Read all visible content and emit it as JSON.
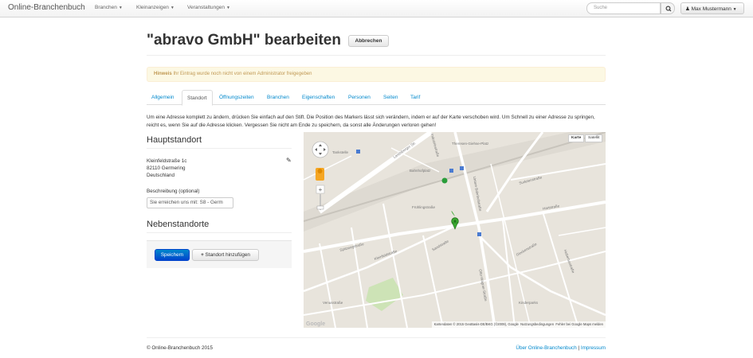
{
  "navbar": {
    "brand": "Online-Branchenbuch",
    "menus": [
      "Branchen",
      "Kleinanzeigen",
      "Veranstaltungen"
    ],
    "search_placeholder": "Suche",
    "user_name": "Max Mustermann"
  },
  "header": {
    "title": "\"abravo GmbH\" bearbeiten",
    "cancel_label": "Abbrechen"
  },
  "alert": {
    "label": "Hinweis",
    "text": "Ihr Eintrag wurde noch nicht von einem Administrator freigegeben"
  },
  "tabs": [
    {
      "label": "Allgemein",
      "active": false
    },
    {
      "label": "Standort",
      "active": true
    },
    {
      "label": "Öffnungszeiten",
      "active": false
    },
    {
      "label": "Branchen",
      "active": false
    },
    {
      "label": "Eigenschaften",
      "active": false
    },
    {
      "label": "Personen",
      "active": false
    },
    {
      "label": "Seiten",
      "active": false
    },
    {
      "label": "Tarif",
      "active": false
    }
  ],
  "intro": "Um eine Adresse komplett zu ändern, drücken Sie einfach auf den Stift. Die Position des Markers lässt sich verändern, indem er auf der Karte verschoben wird. Um Schnell zu einer Adresse zu springen, reicht es, wenn Sie auf die Adresse klicken. Vergessen Sie nicht am Ende zu speichern, da sonst alle Änderungen verloren gehen!",
  "main_location": {
    "heading": "Hauptstandort",
    "street": "Kleinfeldstraße 1c",
    "city": "82110 Germering",
    "country": "Deutschland",
    "description_label": "Beschreibung (optional)",
    "description_value": "Sie erreichen uns mit: S8 - Germ"
  },
  "secondary": {
    "heading": "Nebenstandorte",
    "save_label": "Speichern",
    "add_label": "Standort hinzufügen"
  },
  "map": {
    "type_map": "Karte",
    "type_satellite": "Satellit",
    "attribution": "Kartendaten © 2015 GeoBasis-DE/BKG (©2009), Google",
    "terms": "Nutzungsbedingungen",
    "report": "Fehler bei Google Maps melden",
    "logo": "Google",
    "labels": [
      "Landsberger Str.",
      "Theresen-Giehse-Platz",
      "Bahnhofplatz",
      "Industriestraße",
      "Untere Bahnhofstraße",
      "Frühlingstraße",
      "Sudetenstraße",
      "Hartstraße",
      "Spitzwegstraße",
      "Kleinfeldstraße",
      "Sandstraße",
      "Otto-Wagner-Straße",
      "Kinderparks",
      "Venusstraße",
      "Glockenstraße",
      "Hubertusstraße",
      "Tankstelle"
    ]
  },
  "footer": {
    "copyright": "© Online-Branchenbuch 2015",
    "link_about": "Über Online-Branchenbuch",
    "separator": "|",
    "link_imprint": "Impressum"
  },
  "colors": {
    "link": "#0088cc",
    "primary": "#0044cc",
    "alert_bg": "#fcf8e3",
    "alert_text": "#c09853",
    "map_bg": "#e8e4dc",
    "marker": "#3aa830"
  }
}
